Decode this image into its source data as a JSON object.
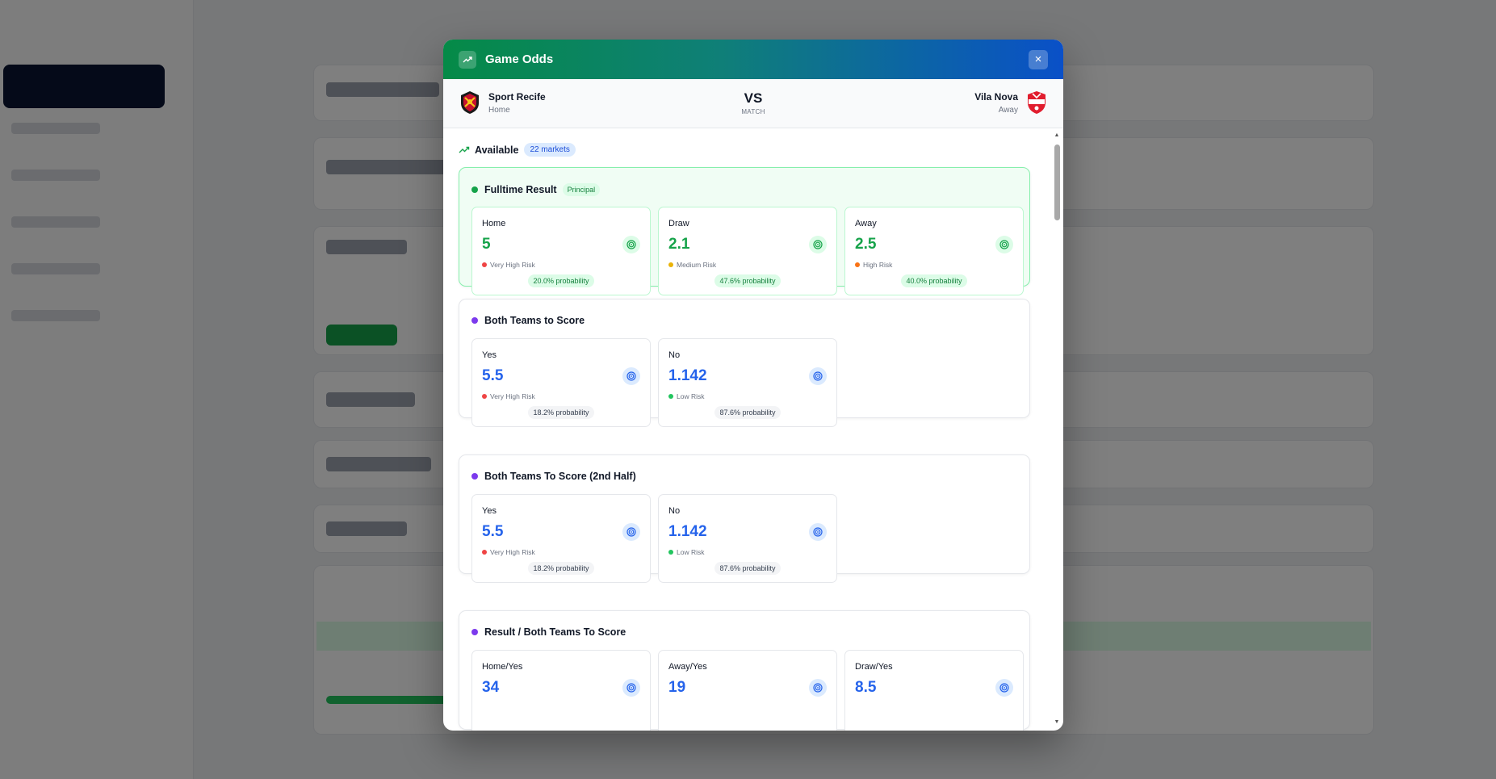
{
  "modal": {
    "title": "Game Odds",
    "close_label": "×"
  },
  "match": {
    "home": {
      "name": "Sport Recife",
      "role": "Home"
    },
    "away": {
      "name": "Vila Nova",
      "role": "Away"
    },
    "vs": "VS",
    "vs_sub": "MATCH"
  },
  "available": {
    "label": "Available",
    "badge": "22 markets"
  },
  "colors": {
    "green": "#16a34a",
    "blue": "#2563eb",
    "purple": "#7c3aed",
    "risk_very_high": "#ef4444",
    "risk_high": "#f97316",
    "risk_medium": "#eab308",
    "risk_low": "#22c55e"
  },
  "markets": [
    {
      "name": "Fulltime Result",
      "tag": "Principal",
      "options": [
        {
          "label": "Home",
          "value": "5",
          "risk": "Very High Risk",
          "probability": "20.0% probability"
        },
        {
          "label": "Draw",
          "value": "2.1",
          "risk": "Medium Risk",
          "probability": "47.6% probability"
        },
        {
          "label": "Away",
          "value": "2.5",
          "risk": "High Risk",
          "probability": "40.0% probability"
        }
      ]
    },
    {
      "name": "Both Teams to Score",
      "options": [
        {
          "label": "Yes",
          "value": "5.5",
          "risk": "Very High Risk",
          "probability": "18.2% probability"
        },
        {
          "label": "No",
          "value": "1.142",
          "risk": "Low Risk",
          "probability": "87.6% probability"
        }
      ]
    },
    {
      "name": "Both Teams To Score (2nd Half)",
      "options": [
        {
          "label": "Yes",
          "value": "5.5",
          "risk": "Very High Risk",
          "probability": "18.2% probability"
        },
        {
          "label": "No",
          "value": "1.142",
          "risk": "Low Risk",
          "probability": "87.6% probability"
        }
      ]
    },
    {
      "name": "Result / Both Teams To Score",
      "options": [
        {
          "label": "Home/Yes",
          "value": "34"
        },
        {
          "label": "Away/Yes",
          "value": "19"
        },
        {
          "label": "Draw/Yes",
          "value": "8.5"
        }
      ]
    }
  ]
}
